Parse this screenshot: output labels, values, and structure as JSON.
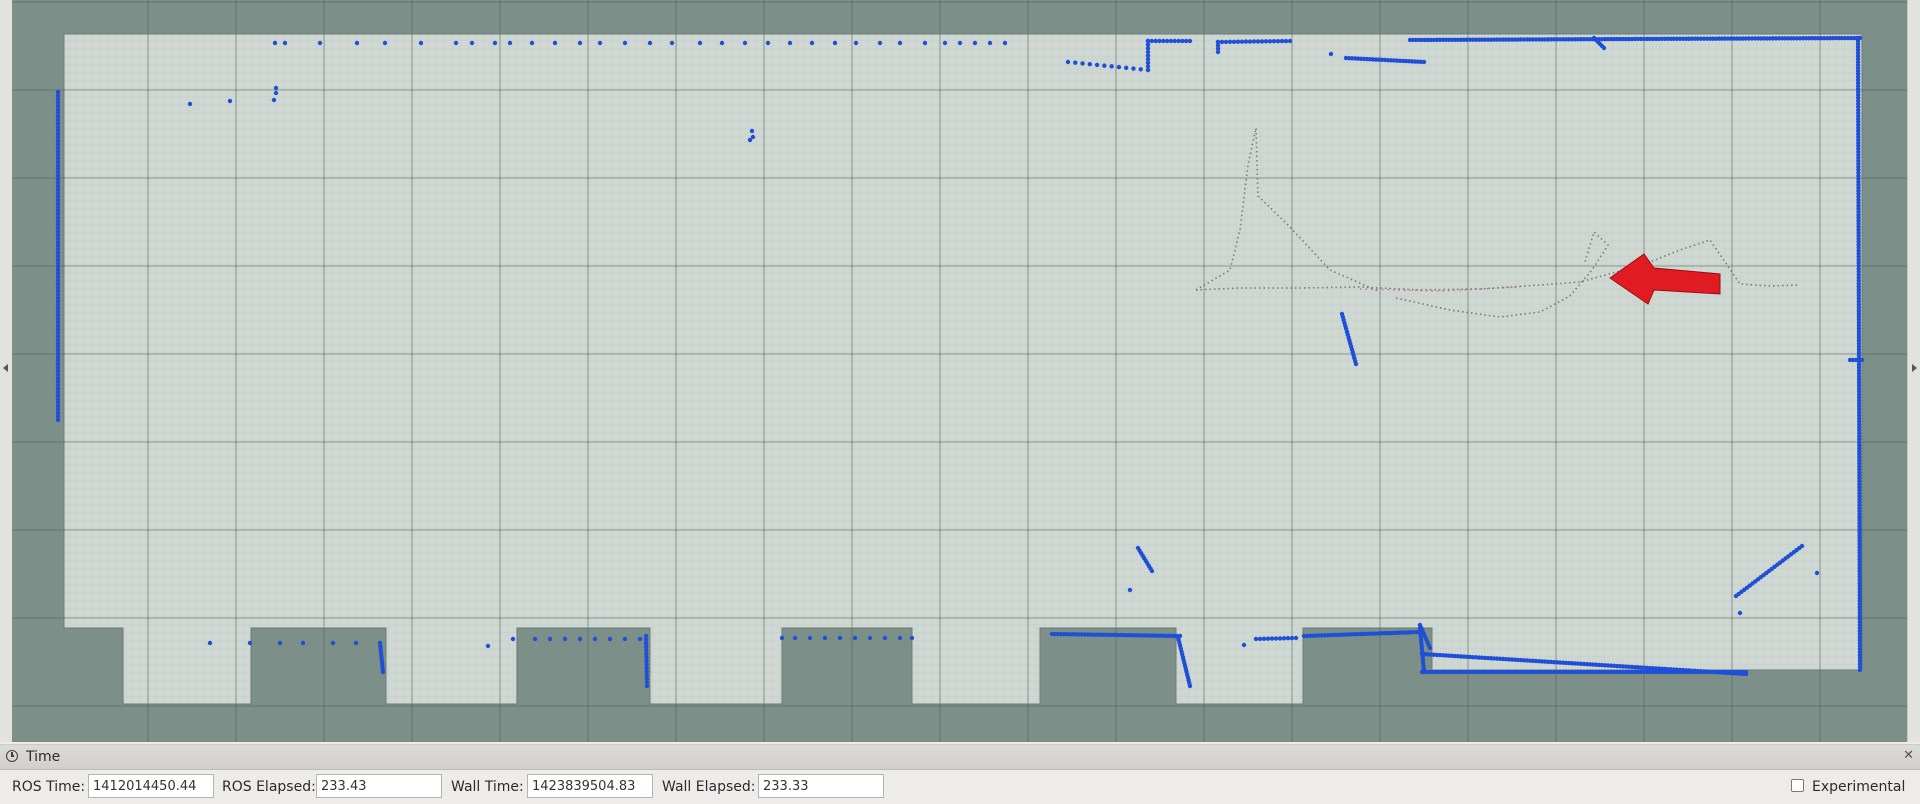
{
  "map_view": {
    "colors": {
      "background": "#7c8f89",
      "free_space": "#cfd7d3",
      "obstacle_points": "#1f4fd6",
      "trajectory": "#6b6b6b",
      "pose_arrow": "#e11b22"
    },
    "icons": [
      "pose-arrow-icon"
    ]
  },
  "time_panel": {
    "title": "Time",
    "close_label": "✕",
    "ros_time_label": "ROS Time:",
    "ros_time_value": "1412014450.44",
    "ros_elapsed_label": "ROS Elapsed:",
    "ros_elapsed_value": "233.43",
    "wall_time_label": "Wall Time:",
    "wall_time_value": "1423839504.83",
    "wall_elapsed_label": "Wall Elapsed:",
    "wall_elapsed_value": "233.33",
    "experimental_label": "Experimental",
    "experimental_checked": false
  }
}
